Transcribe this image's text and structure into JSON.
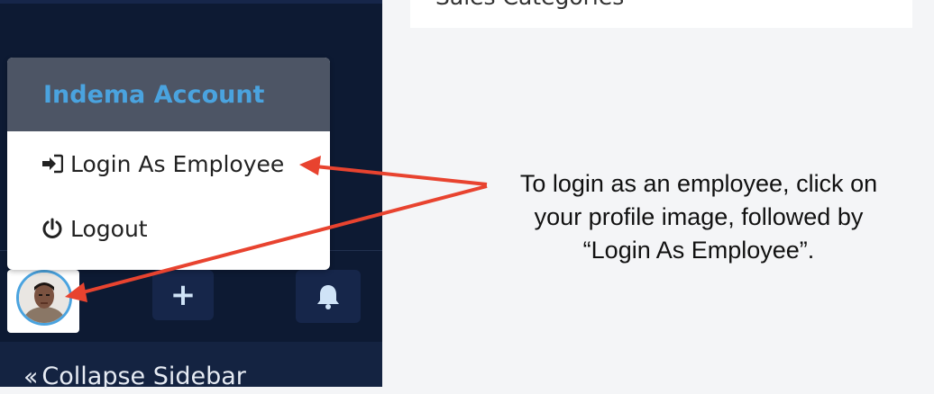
{
  "main": {
    "top_card_label": "Sales Categories"
  },
  "account_menu": {
    "header": "Indema Account",
    "items": [
      {
        "label": "Login As Employee",
        "icon": "sign-in-icon"
      },
      {
        "label": "Logout",
        "icon": "power-icon"
      }
    ]
  },
  "sidebar": {
    "bottom_actions": [
      {
        "icon": "profile-avatar"
      },
      {
        "icon": "plus-icon"
      },
      {
        "icon": "bell-icon"
      }
    ],
    "collapse_label": "Collapse Sidebar"
  },
  "annotation": {
    "text_lines": [
      "To login as an employee, click on",
      "your profile image, followed by",
      "“Login As Employee”."
    ]
  },
  "colors": {
    "sidebar_bg": "#0d1a33",
    "accent_blue": "#4aa3df",
    "arrow_red": "#e8432f",
    "menu_header_bg": "#4d5565"
  }
}
